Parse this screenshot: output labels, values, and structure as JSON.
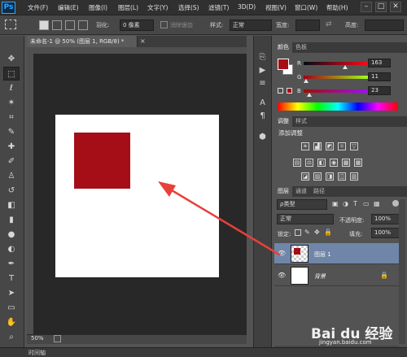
{
  "app": {
    "logo": "Ps",
    "window_controls": [
      "–",
      "□",
      "✕"
    ]
  },
  "menu": [
    "文件(F)",
    "编辑(E)",
    "图像(I)",
    "图层(L)",
    "文字(Y)",
    "选择(S)",
    "滤镜(T)",
    "3D(D)",
    "视图(V)",
    "窗口(W)",
    "帮助(H)"
  ],
  "options_bar": {
    "feather_label": "羽化:",
    "feather_value": "0 像素",
    "antialias_label": "消除锯齿",
    "style_label": "样式:",
    "style_value": "正常",
    "width_label": "宽度:",
    "height_label": "高度:"
  },
  "document": {
    "tab_title": "未命名-1 @ 50% (图层 1, RGB/8) *",
    "zoom": "50%"
  },
  "timeline": {
    "label": "时间轴"
  },
  "color_panel": {
    "tabs": [
      "颜色",
      "色板"
    ],
    "foreground": "#a50e16",
    "background": "#ffffff",
    "channels": [
      {
        "label": "R",
        "value": "163",
        "fraction": 0.64
      },
      {
        "label": "G",
        "value": "11",
        "fraction": 0.04
      },
      {
        "label": "B",
        "value": "23",
        "fraction": 0.09
      }
    ]
  },
  "adjustments_panel": {
    "tabs": [
      "调整",
      "样式"
    ],
    "title": "添加调整",
    "icons": [
      "brightness-icon",
      "levels-icon",
      "curves-icon",
      "exposure-icon",
      "vibrance-icon",
      "hue-saturation-icon",
      "color-balance-icon",
      "black-white-icon",
      "photo-filter-icon",
      "channel-mixer-icon",
      "color-lookup-icon",
      "invert-icon",
      "posterize-icon",
      "threshold-icon",
      "selective-color-icon",
      "gradient-map-icon"
    ]
  },
  "layers_panel": {
    "tabs": [
      "图层",
      "通道",
      "路径"
    ],
    "filter_label": "ρ类型",
    "blend_mode": "正常",
    "opacity_label": "不透明度:",
    "opacity_value": "100%",
    "lock_label": "锁定:",
    "fill_label": "填充:",
    "fill_value": "100%",
    "layers": [
      {
        "name": "图层 1",
        "selected": true
      },
      {
        "name": "背景",
        "selected": false
      }
    ]
  },
  "watermark": {
    "brand": "Bai du 经验",
    "url": "jingyan.baidu.com"
  },
  "colors": {
    "red_square": "#a50e16",
    "annotation_arrow": "#e8403a"
  }
}
